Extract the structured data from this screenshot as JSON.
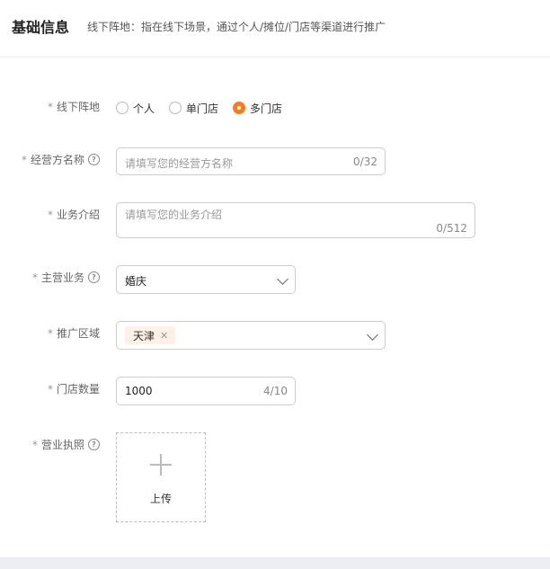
{
  "header": {
    "title": "基础信息",
    "description": "线下阵地：指在线下场景，通过个人/摊位/门店等渠道进行推广"
  },
  "form": {
    "offline_position": {
      "label": "线下阵地",
      "options": [
        "个人",
        "单门店",
        "多门店"
      ],
      "selected": "多门店"
    },
    "operator_name": {
      "label": "经营方名称",
      "placeholder": "请填写您的经营方名称",
      "counter": "0/32"
    },
    "business_intro": {
      "label": "业务介绍",
      "placeholder": "请填写您的业务介绍",
      "counter": "0/512"
    },
    "main_business": {
      "label": "主营业务",
      "value": "婚庆"
    },
    "promo_region": {
      "label": "推广区域",
      "tags": [
        "天津"
      ]
    },
    "store_count": {
      "label": "门店数量",
      "value": "1000",
      "counter": "4/10"
    },
    "business_license": {
      "label": "营业执照",
      "upload_label": "上传"
    },
    "required_mark": "*",
    "help_glyph": "?"
  },
  "colors": {
    "accent": "#ff7a1a",
    "tag_bg": "#fdf1e7"
  }
}
